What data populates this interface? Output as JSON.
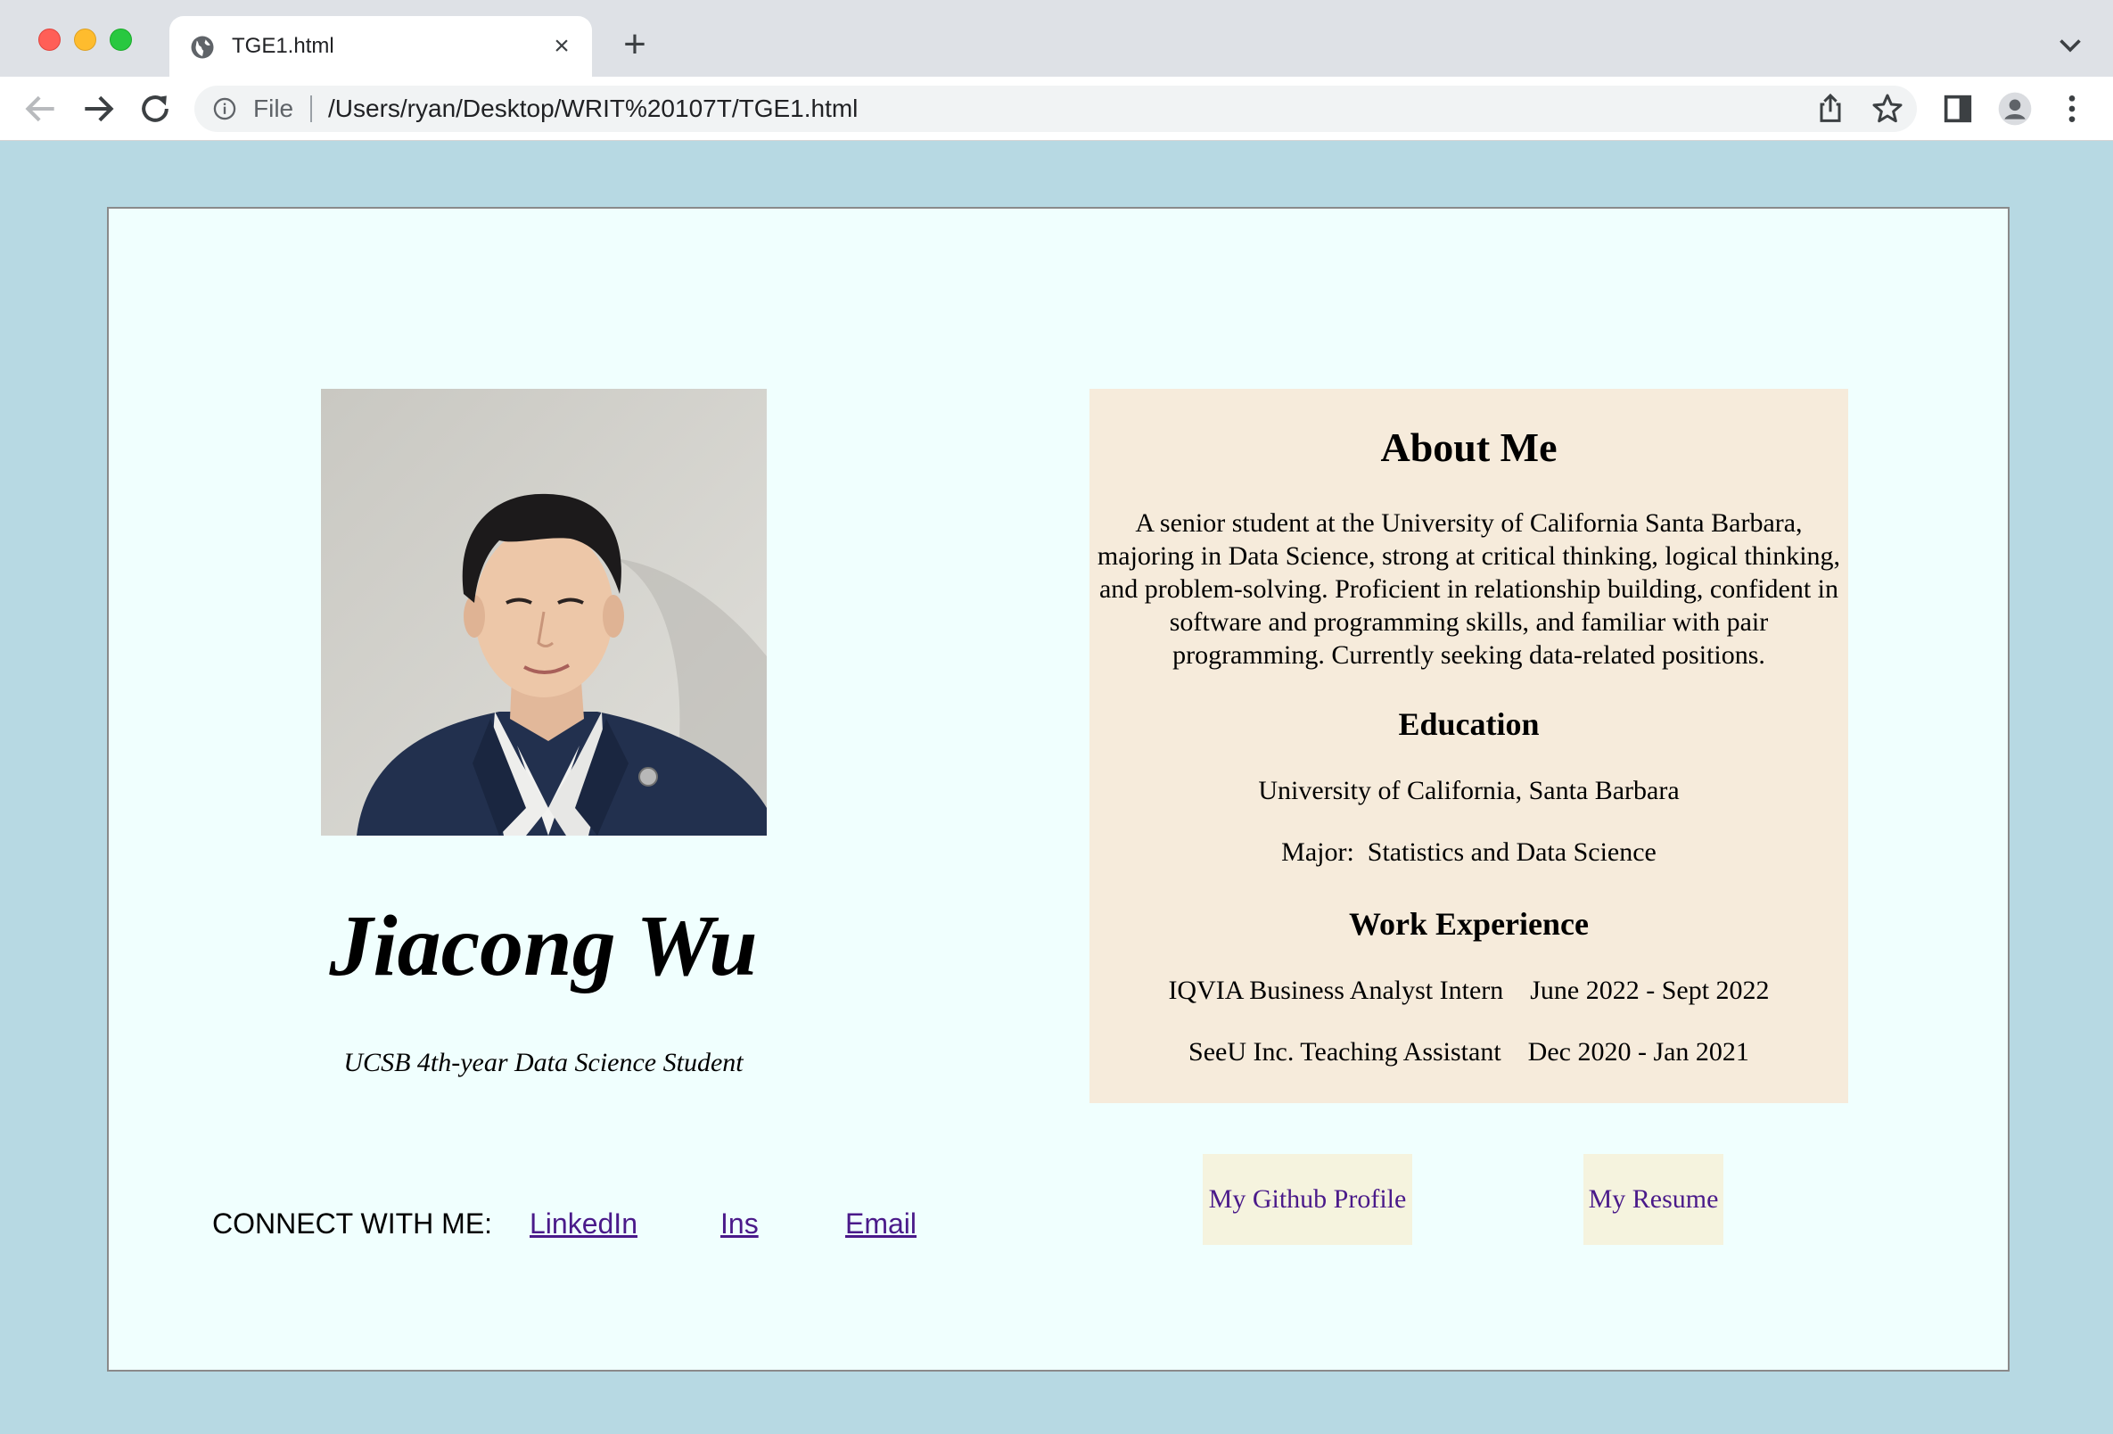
{
  "browser": {
    "tab_title": "TGE1.html",
    "omnibox_label": "File",
    "url": "/Users/ryan/Desktop/WRIT%20107T/TGE1.html"
  },
  "profile": {
    "name": "Jiacong Wu",
    "subtitle": "UCSB 4th-year Data Science Student",
    "connect_label": "CONNECT WITH ME:",
    "links": [
      "LinkedIn",
      "Ins",
      "Email"
    ]
  },
  "about": {
    "heading": "About Me",
    "bio": "A senior student at the University of California Santa Barbara, majoring in Data Science, strong at critical thinking, logical thinking, and problem-solving. Proficient in relationship building, confident in software and programming skills, and familiar with pair programming. Currently seeking data-related positions.",
    "education_heading": "Education",
    "school": "University of California, Santa Barbara",
    "major": "Major:  Statistics and Data Science",
    "work_heading": "Work Experience",
    "jobs": [
      "IQVIA Business Analyst Intern    June 2022 - Sept 2022",
      "SeeU Inc. Teaching Assistant    Dec 2020 - Jan 2021"
    ]
  },
  "buttons": {
    "github": "My Github Profile",
    "resume": "My Resume"
  }
}
